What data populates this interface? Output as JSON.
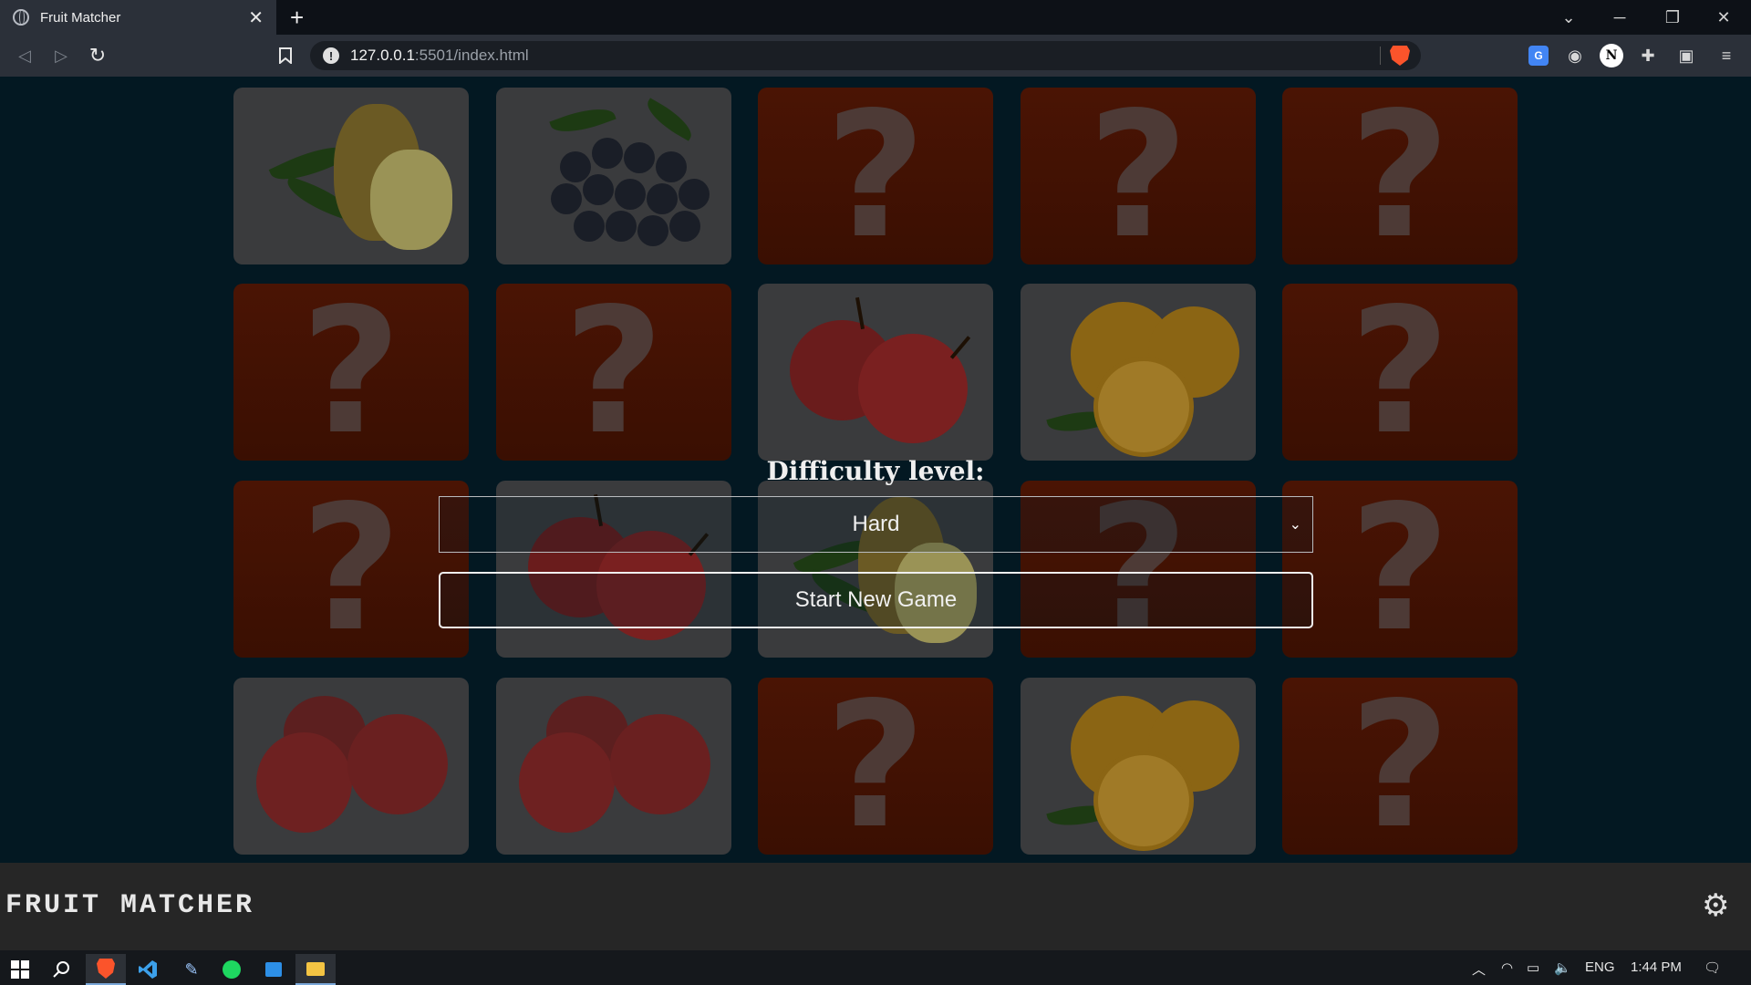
{
  "browser": {
    "tab_title": "Fruit Matcher",
    "url_host": "127.0.0.1",
    "url_path": ":5501/index.html",
    "new_tab": "+",
    "tab_close": "✕"
  },
  "game": {
    "board": [
      [
        "pineapple",
        "blueberries",
        "hidden",
        "hidden",
        "hidden"
      ],
      [
        "hidden",
        "hidden",
        "apple",
        "orange",
        "hidden"
      ],
      [
        "hidden",
        "apple",
        "pineapple",
        "hidden",
        "hidden"
      ],
      [
        "plum",
        "plum",
        "hidden",
        "orange",
        "hidden"
      ]
    ],
    "hidden_symbol": "?",
    "difficulty_label": "Difficulty level:",
    "difficulty_value": "Hard",
    "start_button": "Start New Game"
  },
  "footer": {
    "title": "FRUIT MATCHER"
  },
  "taskbar": {
    "language": "ENG",
    "time": "1:44 PM"
  },
  "colors": {
    "page_bg": "#031822",
    "card_back": "#4a1404",
    "footer_bg": "#262626",
    "brave_orange": "#fb542b"
  }
}
